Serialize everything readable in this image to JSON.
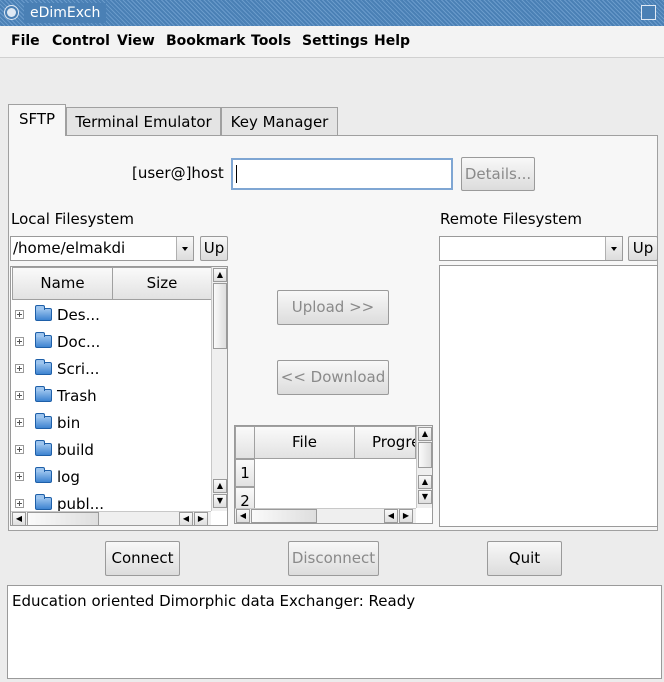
{
  "window": {
    "title": "eDimExch"
  },
  "menubar": {
    "items": [
      "File",
      "Control",
      "View",
      "Bookmark",
      "Tools",
      "Settings",
      "Help"
    ]
  },
  "tabs": [
    "SFTP",
    "Terminal Emulator",
    "Key Manager"
  ],
  "sftp": {
    "host_label": "[user@]host",
    "host_value": "",
    "details_button": "Details...",
    "local_label": "Local Filesystem",
    "local_path": "/home/elmakdi",
    "local_up": "Up",
    "remote_label": "Remote Filesystem",
    "remote_path": "",
    "remote_up": "Up",
    "local_columns": [
      "Name",
      "Size"
    ],
    "local_items": [
      "Des...",
      "Doc...",
      "Scri...",
      "Trash",
      "bin",
      "build",
      "log",
      "publ..."
    ],
    "upload_button": "Upload  >>",
    "download_button": "<< Download",
    "transfer_columns": [
      "File",
      "Progre"
    ],
    "transfer_rows": [
      "1",
      "2"
    ]
  },
  "buttons": {
    "connect": "Connect",
    "disconnect": "Disconnect",
    "quit": "Quit"
  },
  "status_text": "Education oriented Dimorphic data Exchanger: Ready"
}
